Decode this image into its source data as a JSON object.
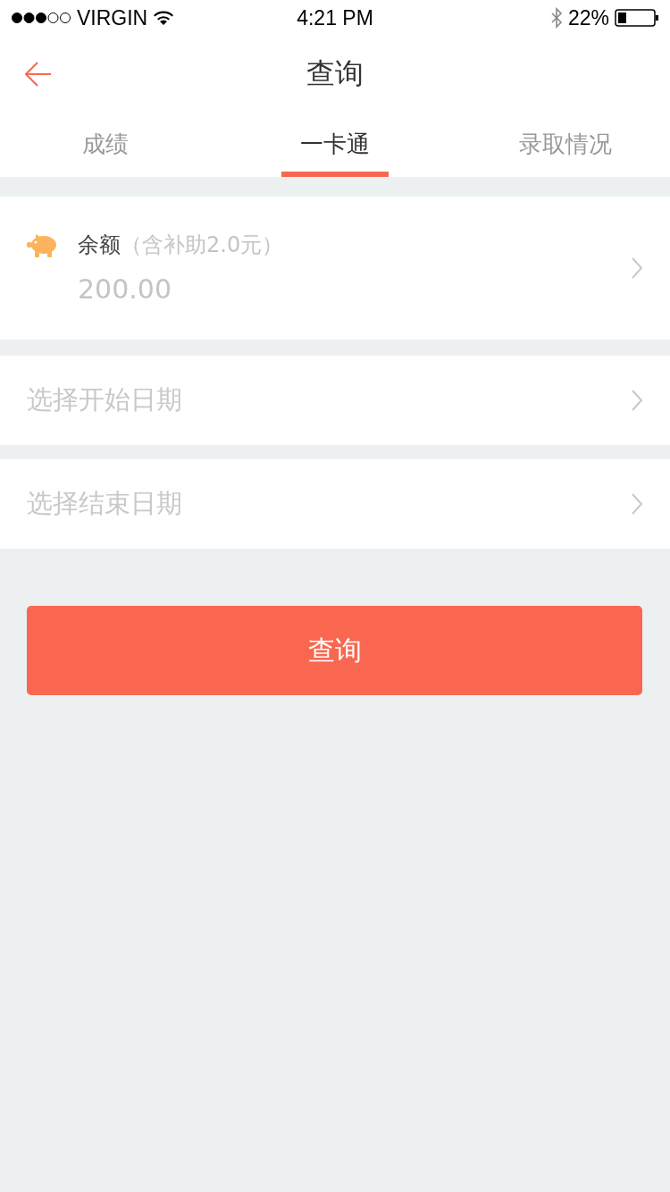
{
  "status_bar": {
    "carrier": "VIRGIN",
    "time": "4:21 PM",
    "battery": "22%"
  },
  "nav": {
    "title": "查询"
  },
  "tabs": [
    {
      "label": "成绩",
      "selected": false
    },
    {
      "label": "一卡通",
      "selected": true
    },
    {
      "label": "录取情况",
      "selected": false
    }
  ],
  "balance": {
    "label": "余额",
    "note": "（含补助2.0元）",
    "amount": "200.00"
  },
  "date_rows": [
    {
      "placeholder": "选择开始日期"
    },
    {
      "placeholder": "选择结束日期"
    }
  ],
  "query_button": "查询"
}
